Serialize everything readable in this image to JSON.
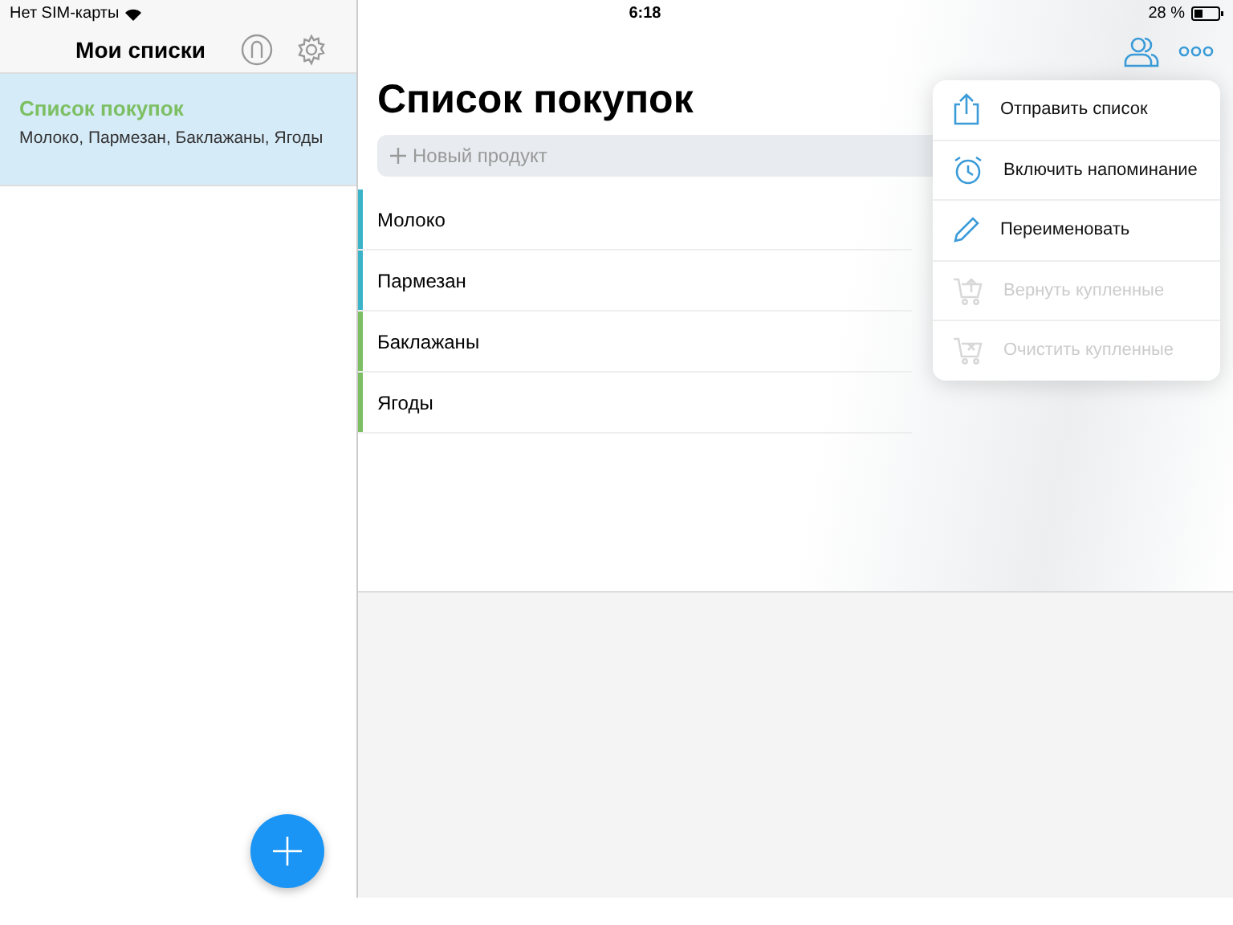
{
  "status_bar": {
    "carrier": "Нет SIM-карты",
    "time": "6:18",
    "battery": "28 %"
  },
  "sidebar": {
    "title": "Мои списки",
    "lists": [
      {
        "name": "Список покупок",
        "summary": "Молоко, Пармезан, Баклажаны, Ягоды",
        "selected": true
      }
    ]
  },
  "list": {
    "title": "Список покупок",
    "new_item": {
      "placeholder": "Новый продукт"
    },
    "items": [
      {
        "name": "Молоко",
        "color": "#3bb3c9"
      },
      {
        "name": "Пармезан",
        "color": "#3bb3c9"
      },
      {
        "name": "Баклажаны",
        "color": "#7cbf63"
      },
      {
        "name": "Ягоды",
        "color": "#7cbf63"
      }
    ]
  },
  "menu": [
    {
      "kind": "share",
      "label": "Отправить список",
      "disabled": false
    },
    {
      "kind": "alarm",
      "label": "Включить напоминание",
      "disabled": false
    },
    {
      "kind": "pencil",
      "label": "Переименовать",
      "disabled": false
    },
    {
      "kind": "cart-up",
      "label": "Вернуть купленные",
      "disabled": true
    },
    {
      "kind": "cart-x",
      "label": "Очистить купленные",
      "disabled": true
    }
  ]
}
